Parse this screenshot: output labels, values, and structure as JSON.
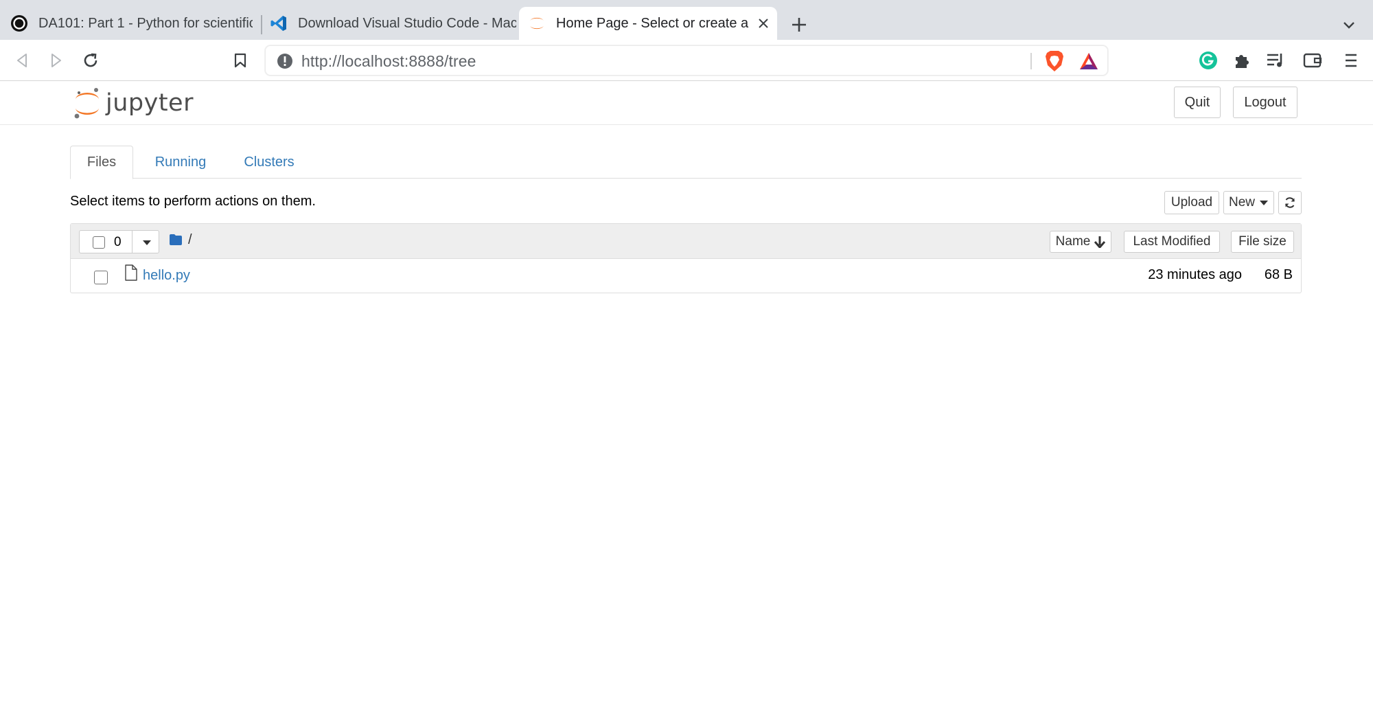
{
  "browser": {
    "tabs": [
      {
        "title": "DA101: Part 1 - Python for scientific",
        "favicon": "circle-logo-icon"
      },
      {
        "title": "Download Visual Studio Code - Mac",
        "favicon": "vscode-icon"
      },
      {
        "title": "Home Page - Select or create a",
        "favicon": "jupyter-icon",
        "active": true
      }
    ],
    "url": "http://localhost:8888/tree"
  },
  "jupyter": {
    "logo_text": "jupyter",
    "quit_label": "Quit",
    "logout_label": "Logout",
    "tabs": [
      "Files",
      "Running",
      "Clusters"
    ],
    "active_tab": "Files",
    "instructions": "Select items to perform actions on them.",
    "upload_label": "Upload",
    "new_label": "New",
    "selected_count": "0",
    "breadcrumb": "/",
    "columns": {
      "name": "Name",
      "modified": "Last Modified",
      "size": "File size"
    },
    "files": [
      {
        "name": "hello.py",
        "modified": "23 minutes ago",
        "size": "68 B"
      }
    ]
  },
  "colors": {
    "jupyter_orange": "#f37726",
    "link_blue": "#337ab7",
    "tabstrip": "#dee1e6",
    "folder_blue": "#2a6ebb"
  }
}
